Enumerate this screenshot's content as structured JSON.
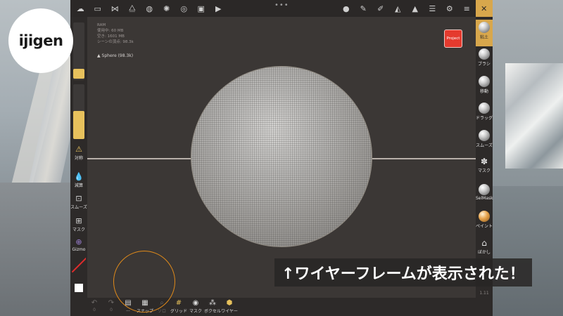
{
  "logo": {
    "text": "ijigen"
  },
  "top_toolbar": {
    "left_icons": [
      "folder-icon",
      "scene-graph-icon",
      "topology-icon",
      "globe-icon",
      "sun-icon",
      "material-icon",
      "image-icon",
      "video-icon"
    ],
    "right_icons": [
      "matcap-icon",
      "pen-icon",
      "pipette-icon",
      "bucket-icon",
      "triangle-icon",
      "layers-icon",
      "gear-icon",
      "sliders-icon",
      "tools-icon"
    ],
    "more": "•••"
  },
  "stats": {
    "lines": [
      "RAM",
      "使用中: 60 MB",
      "空き: 1601 MB",
      "シーンの頂点: 98.3k"
    ]
  },
  "object_label": "Sphere (98.3k)",
  "project_button": "Project",
  "left_toolbar": {
    "slider_values": [
      0.12,
      0.32
    ],
    "symmetry_label": "対称",
    "items": [
      {
        "icon": "drop-icon",
        "label": "減算"
      },
      {
        "icon": "smooth-icon",
        "label": "スムーズ"
      },
      {
        "icon": "mask-icon",
        "label": "マスク"
      },
      {
        "icon": "gizmo-icon",
        "label": "Gizmo"
      }
    ]
  },
  "right_toolbar": {
    "items": [
      {
        "label": "粘土",
        "active": true
      },
      {
        "label": "ブラシ",
        "active": false
      },
      {
        "label": "移動",
        "active": false
      },
      {
        "label": "ドラッグ",
        "active": false
      },
      {
        "label": "スムーズ",
        "active": false
      },
      {
        "label": "マスク",
        "active": false
      },
      {
        "label": "SelMask",
        "active": false
      },
      {
        "label": "ペイント",
        "active": false
      },
      {
        "label": "ぼかし",
        "active": false
      }
    ],
    "extra_label": "1.11"
  },
  "bottom_toolbar": {
    "items": [
      {
        "icon": "undo-icon",
        "label": "0",
        "dim": true
      },
      {
        "icon": "redo-icon",
        "label": "0",
        "dim": true
      },
      {
        "icon": "book-icon",
        "label": "...",
        "dim": false
      },
      {
        "icon": "snapshot-icon",
        "label": "スナップ",
        "dim": false
      },
      {
        "icon": "search-icon",
        "label": "ソロ",
        "dim": true
      },
      {
        "icon": "grid-icon",
        "label": "グリッド",
        "dim": false
      },
      {
        "icon": "eye-icon",
        "label": "マスク",
        "dim": false
      },
      {
        "icon": "voxel-icon",
        "label": "ボクセル",
        "dim": false
      },
      {
        "icon": "wireframe-icon",
        "label": "ワイヤー",
        "dim": false
      }
    ]
  },
  "caption": "↑ワイヤーフレームが表示された！",
  "colors": {
    "accent": "#d8a74c",
    "project": "#e53a2e",
    "gizmo_ring": "#e08a1a"
  }
}
